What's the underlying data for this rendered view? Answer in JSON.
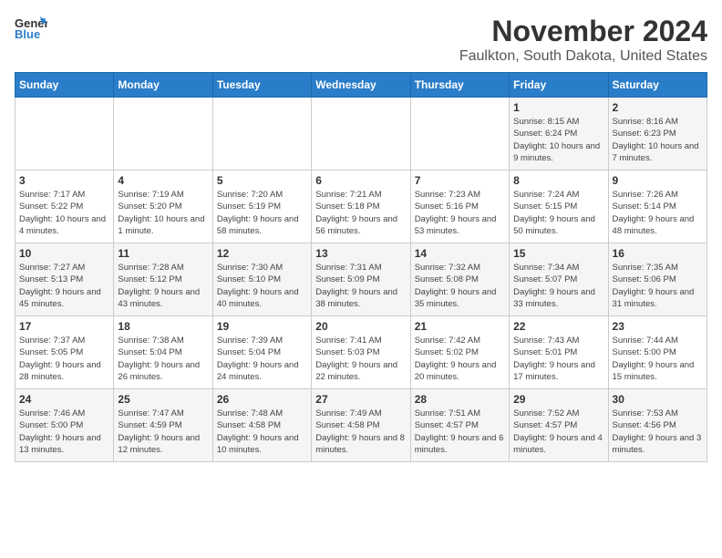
{
  "app": {
    "logo_general": "General",
    "logo_blue": "Blue",
    "title": "November 2024",
    "subtitle": "Faulkton, South Dakota, United States"
  },
  "calendar": {
    "headers": [
      "Sunday",
      "Monday",
      "Tuesday",
      "Wednesday",
      "Thursday",
      "Friday",
      "Saturday"
    ],
    "weeks": [
      [
        {
          "day": "",
          "info": ""
        },
        {
          "day": "",
          "info": ""
        },
        {
          "day": "",
          "info": ""
        },
        {
          "day": "",
          "info": ""
        },
        {
          "day": "",
          "info": ""
        },
        {
          "day": "1",
          "info": "Sunrise: 8:15 AM\nSunset: 6:24 PM\nDaylight: 10 hours and 9 minutes."
        },
        {
          "day": "2",
          "info": "Sunrise: 8:16 AM\nSunset: 6:23 PM\nDaylight: 10 hours and 7 minutes."
        }
      ],
      [
        {
          "day": "3",
          "info": "Sunrise: 7:17 AM\nSunset: 5:22 PM\nDaylight: 10 hours and 4 minutes."
        },
        {
          "day": "4",
          "info": "Sunrise: 7:19 AM\nSunset: 5:20 PM\nDaylight: 10 hours and 1 minute."
        },
        {
          "day": "5",
          "info": "Sunrise: 7:20 AM\nSunset: 5:19 PM\nDaylight: 9 hours and 58 minutes."
        },
        {
          "day": "6",
          "info": "Sunrise: 7:21 AM\nSunset: 5:18 PM\nDaylight: 9 hours and 56 minutes."
        },
        {
          "day": "7",
          "info": "Sunrise: 7:23 AM\nSunset: 5:16 PM\nDaylight: 9 hours and 53 minutes."
        },
        {
          "day": "8",
          "info": "Sunrise: 7:24 AM\nSunset: 5:15 PM\nDaylight: 9 hours and 50 minutes."
        },
        {
          "day": "9",
          "info": "Sunrise: 7:26 AM\nSunset: 5:14 PM\nDaylight: 9 hours and 48 minutes."
        }
      ],
      [
        {
          "day": "10",
          "info": "Sunrise: 7:27 AM\nSunset: 5:13 PM\nDaylight: 9 hours and 45 minutes."
        },
        {
          "day": "11",
          "info": "Sunrise: 7:28 AM\nSunset: 5:12 PM\nDaylight: 9 hours and 43 minutes."
        },
        {
          "day": "12",
          "info": "Sunrise: 7:30 AM\nSunset: 5:10 PM\nDaylight: 9 hours and 40 minutes."
        },
        {
          "day": "13",
          "info": "Sunrise: 7:31 AM\nSunset: 5:09 PM\nDaylight: 9 hours and 38 minutes."
        },
        {
          "day": "14",
          "info": "Sunrise: 7:32 AM\nSunset: 5:08 PM\nDaylight: 9 hours and 35 minutes."
        },
        {
          "day": "15",
          "info": "Sunrise: 7:34 AM\nSunset: 5:07 PM\nDaylight: 9 hours and 33 minutes."
        },
        {
          "day": "16",
          "info": "Sunrise: 7:35 AM\nSunset: 5:06 PM\nDaylight: 9 hours and 31 minutes."
        }
      ],
      [
        {
          "day": "17",
          "info": "Sunrise: 7:37 AM\nSunset: 5:05 PM\nDaylight: 9 hours and 28 minutes."
        },
        {
          "day": "18",
          "info": "Sunrise: 7:38 AM\nSunset: 5:04 PM\nDaylight: 9 hours and 26 minutes."
        },
        {
          "day": "19",
          "info": "Sunrise: 7:39 AM\nSunset: 5:04 PM\nDaylight: 9 hours and 24 minutes."
        },
        {
          "day": "20",
          "info": "Sunrise: 7:41 AM\nSunset: 5:03 PM\nDaylight: 9 hours and 22 minutes."
        },
        {
          "day": "21",
          "info": "Sunrise: 7:42 AM\nSunset: 5:02 PM\nDaylight: 9 hours and 20 minutes."
        },
        {
          "day": "22",
          "info": "Sunrise: 7:43 AM\nSunset: 5:01 PM\nDaylight: 9 hours and 17 minutes."
        },
        {
          "day": "23",
          "info": "Sunrise: 7:44 AM\nSunset: 5:00 PM\nDaylight: 9 hours and 15 minutes."
        }
      ],
      [
        {
          "day": "24",
          "info": "Sunrise: 7:46 AM\nSunset: 5:00 PM\nDaylight: 9 hours and 13 minutes."
        },
        {
          "day": "25",
          "info": "Sunrise: 7:47 AM\nSunset: 4:59 PM\nDaylight: 9 hours and 12 minutes."
        },
        {
          "day": "26",
          "info": "Sunrise: 7:48 AM\nSunset: 4:58 PM\nDaylight: 9 hours and 10 minutes."
        },
        {
          "day": "27",
          "info": "Sunrise: 7:49 AM\nSunset: 4:58 PM\nDaylight: 9 hours and 8 minutes."
        },
        {
          "day": "28",
          "info": "Sunrise: 7:51 AM\nSunset: 4:57 PM\nDaylight: 9 hours and 6 minutes."
        },
        {
          "day": "29",
          "info": "Sunrise: 7:52 AM\nSunset: 4:57 PM\nDaylight: 9 hours and 4 minutes."
        },
        {
          "day": "30",
          "info": "Sunrise: 7:53 AM\nSunset: 4:56 PM\nDaylight: 9 hours and 3 minutes."
        }
      ]
    ]
  }
}
